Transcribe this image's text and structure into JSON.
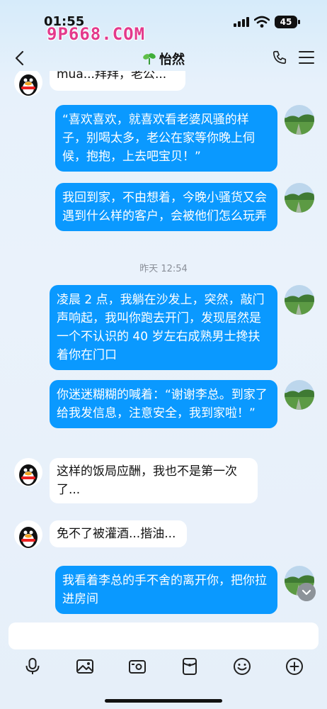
{
  "status_bar": {
    "time": "01:55",
    "battery": "45"
  },
  "watermark": "9P668.COM",
  "header": {
    "title": "怡然"
  },
  "messages": {
    "m0": "mua...拜拜，老公...",
    "m1": "“喜欢喜欢，就喜欢看老婆风骚的样子，别喝太多，老公在家等你晚上伺候，抱抱，上去吧宝贝！”",
    "m2": "我回到家，不由想着，今晚小骚货又会遇到什么样的客户，会被他们怎么玩弄",
    "timestamp": "昨天 12:54",
    "m3": "凌晨 2 点，我躺在沙发上，突然，敲门声响起，我叫你跑去开门，发现居然是一个不认识的 40 岁左右成熟男士搀扶着你在门口",
    "m4": "你迷迷糊糊的喊着：“谢谢李总。到家了给我发信息，注意安全，我到家啦！”",
    "m5": "这样的饭局应酬，我也不是第一次了...",
    "m6": "免不了被灌酒...揩油...",
    "m7": "我看着李总的手不舍的离开你，把你拉进房间"
  },
  "icons": {
    "back": "chevron-left-icon",
    "phone": "phone-icon",
    "menu": "hamburger-menu-icon",
    "toolbar": [
      "microphone-icon",
      "image-icon",
      "camera-icon",
      "red-packet-icon",
      "emoji-icon",
      "plus-icon"
    ]
  },
  "colors": {
    "bubble_sent": "#0a99ff",
    "bubble_received": "#ffffff",
    "watermark": "#e33a8c"
  }
}
